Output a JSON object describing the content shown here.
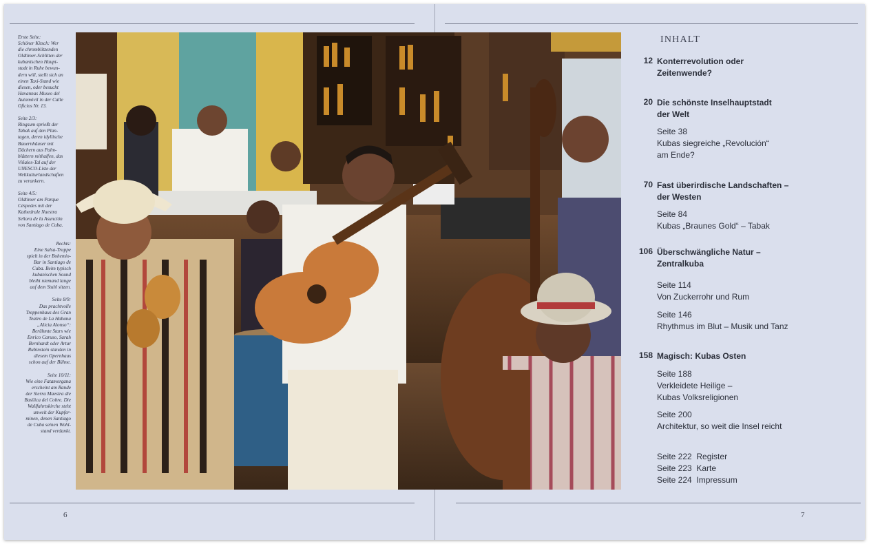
{
  "captions": [
    {
      "align": "left",
      "lines": [
        "Erste Seite:",
        "Schöner Kitsch: Wer",
        "die chromblitzenden",
        "Oldtimer-Schlitten der",
        "kubanischen Haupt-",
        "stadt in Ruhe bewun-",
        "dern will, stellt sich an",
        "einen Taxi-Stand wie",
        "diesen, oder besucht",
        "Havannas Museo del",
        "Automóvil in der Calle",
        "Oficios Nr. 13."
      ]
    },
    {
      "align": "left",
      "lines": [
        "Seite 2/3:",
        "Ringsum sprießt der",
        "Tabak auf den Plan-",
        "tagen, deren idyllische",
        "Bauernhäuser mit",
        "Dächern aus Palm-",
        "blättern mithalfen, das",
        "Viñales-Tal auf der",
        "UNESCO-Liste der",
        "Weltkulturlandschaften",
        "zu verankern."
      ]
    },
    {
      "align": "left",
      "lines": [
        "Seite 4/5:",
        "Oldtimer am Parque",
        "Céspedes mit der",
        "Kathedrale Nuestra",
        "Señora de la Asunción",
        "von Santiago de Cuba."
      ]
    },
    {
      "align": "right",
      "lines": [
        "Rechts:",
        "Eine Salsa-Truppe",
        "spielt in der Bohemio-",
        "Bar in Santiago de",
        "Cuba. Beim typisch",
        "kubanischen Sound",
        "bleibt niemand lange",
        "auf dem Stuhl sitzen."
      ]
    },
    {
      "align": "right",
      "lines": [
        "Seite 8/9:",
        "Das prachtvolle",
        "Treppenhaus des Gran",
        "Teatro de La Habana",
        "„Alicia Alonso“:",
        "Berühmte Stars wie",
        "Enrico Caruso, Sarah",
        "Bernhardt oder Artur",
        "Rubinstein standen in",
        "diesem Opernhaus",
        "schon auf der Bühne."
      ]
    },
    {
      "align": "right",
      "lines": [
        "Seite 10/11:",
        "Wie eine Fatamorgana",
        "erscheint am Rande",
        "der Sierra Maestra die",
        "Basílica del Cobre. Die",
        "Wallfahrtskirche steht",
        "unweit der Kupfer-",
        "minen, denen Santiago",
        "de Cuba seinen Wohl-",
        "stand verdankt."
      ]
    }
  ],
  "page_left": "6",
  "page_right": "7",
  "toc": {
    "title": "INHALT",
    "entries": [
      {
        "num": "12",
        "title_lines": [
          "Konterrevolution oder",
          "Zeitenwende?"
        ],
        "subs": []
      },
      {
        "num": "20",
        "title_lines": [
          "Die schönste Inselhauptstadt",
          "der Welt"
        ],
        "subs": [
          [
            "Seite 38",
            "Kubas siegreiche „Revolución“",
            "am Ende?"
          ]
        ]
      },
      {
        "num": "70",
        "title_lines": [
          "Fast überirdische Landschaften –",
          "der Westen"
        ],
        "subs": [
          [
            "Seite 84",
            "Kubas „Braunes Gold“ – Tabak"
          ]
        ]
      },
      {
        "num": "106",
        "title_lines": [
          "Überschwängliche Natur –",
          "Zentralkuba"
        ],
        "subs": [
          [
            "Seite 114",
            "Von Zuckerrohr und Rum"
          ],
          [
            "Seite 146",
            "Rhythmus im Blut – Musik und Tanz"
          ]
        ]
      },
      {
        "num": "158",
        "title_lines": [
          "Magisch: Kubas Osten"
        ],
        "subs": [
          [
            "Seite 188",
            "Verkleidete Heilige –",
            "Kubas Volksreligionen"
          ],
          [
            "Seite 200",
            "Architektur, so weit die Insel reicht"
          ]
        ]
      }
    ],
    "appendix": [
      "Seite 222  Register",
      "Seite 223  Karte",
      "Seite 224  Impressum"
    ]
  },
  "colors": {
    "page_bg": "#dadfed",
    "text": "#2b2f3a",
    "rule": "#7c8192"
  }
}
